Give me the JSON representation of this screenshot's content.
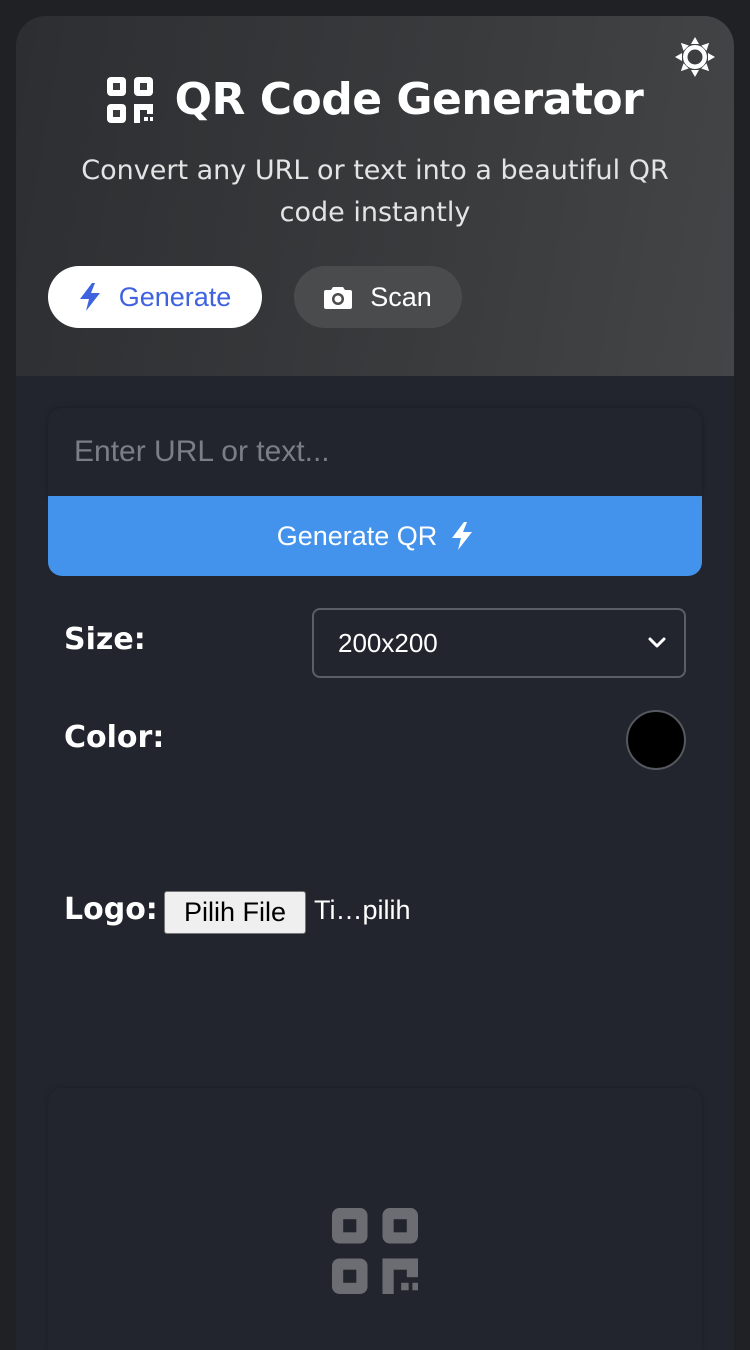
{
  "app": {
    "title": "QR Code Generator",
    "subtitle": "Convert any URL or text into a beautiful QR code instantly",
    "theme_toggle_icon": "sun-icon",
    "brand_icon": "qr-code-icon"
  },
  "tabs": [
    {
      "label": "Generate",
      "icon": "bolt-icon",
      "active": true
    },
    {
      "label": "Scan",
      "icon": "camera-icon",
      "active": false
    }
  ],
  "input": {
    "placeholder": "Enter URL or text...",
    "value": ""
  },
  "generate_button": {
    "label": "Generate QR",
    "icon": "bolt-icon"
  },
  "options": {
    "size_label": "Size:",
    "size_value": "200x200",
    "color_label": "Color:",
    "color_value": "#000000",
    "logo_label": "Logo:",
    "file_button_label": "Pilih File",
    "file_status": "Ti…pilih"
  },
  "preview": {
    "placeholder_icon": "qr-code-icon"
  },
  "colors": {
    "accent": "#4393ed",
    "tab_active_text": "#3f63e0",
    "background": "#22252d"
  }
}
